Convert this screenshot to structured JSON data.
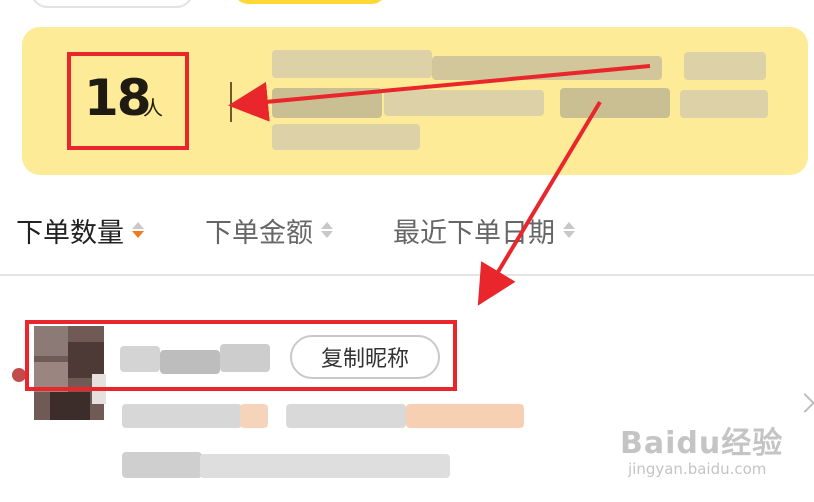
{
  "summary": {
    "count": "18",
    "unit": "人"
  },
  "sort_options": [
    {
      "label": "下单数量",
      "active": true
    },
    {
      "label": "下单金额",
      "active": false
    },
    {
      "label": "最近下单日期",
      "active": false
    }
  ],
  "customer": {
    "copy_label": "复制昵称"
  },
  "watermark": {
    "logo": "Baidu经验",
    "url": "jingyan.baidu.com"
  },
  "colors": {
    "summary_bg": "#fdeb97",
    "highlight_red": "#e8262b",
    "active_sort_caret": "#f07b1b",
    "brand_yellow": "#ffd836"
  }
}
